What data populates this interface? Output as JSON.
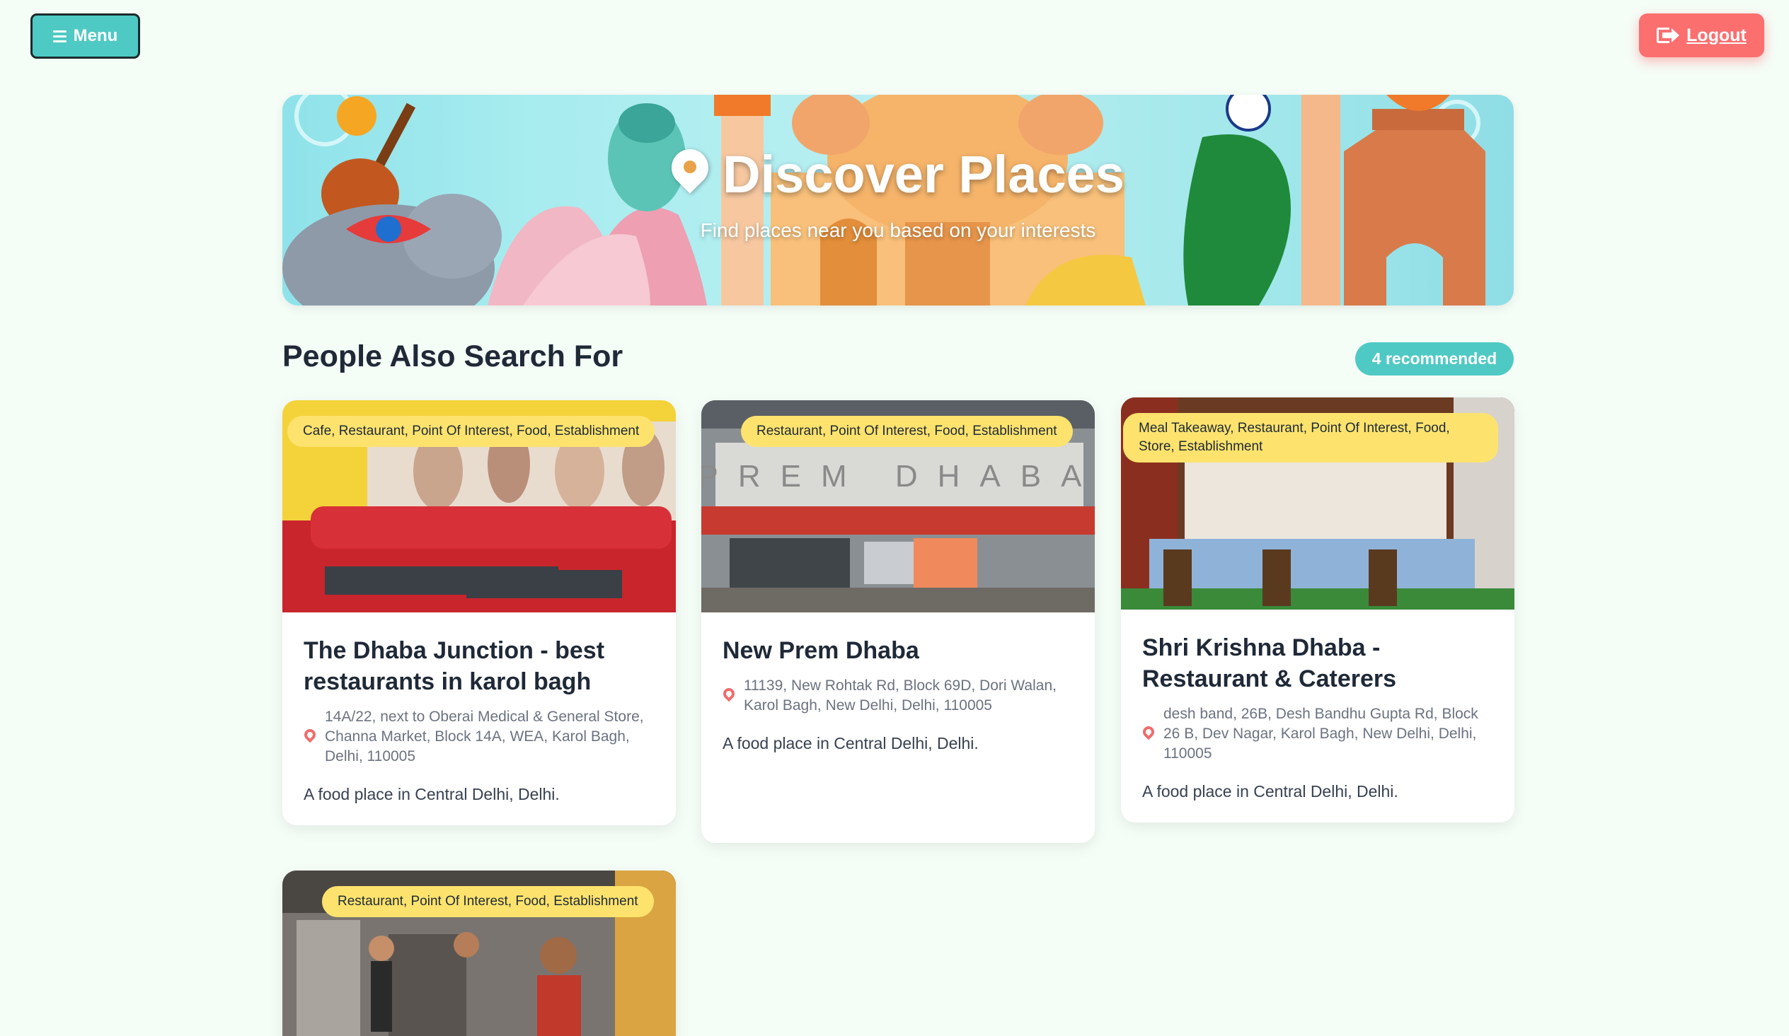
{
  "header": {
    "menu_label": "Menu",
    "logout_label": "Logout"
  },
  "hero": {
    "title": "Discover Places",
    "subtitle": "Find places near you based on your interests"
  },
  "section": {
    "title": "People Also Search For",
    "badge": "4 recommended"
  },
  "colors": {
    "accent": "#4fc9c4",
    "logout": "#fb6f6f",
    "tag": "#fde36d",
    "pin": "#f16b6b"
  },
  "cards": [
    {
      "tags": "Cafe, Restaurant, Point Of Interest, Food, Establishment",
      "title": "The Dhaba Junction - best restaurants in karol bagh",
      "address": "14A/22, next to Oberai Medical & General Store, Channa Market, Block 14A, WEA, Karol Bagh, Delhi, 110005",
      "description": "A food place in Central Delhi, Delhi."
    },
    {
      "tags": "Restaurant, Point Of Interest, Food, Establishment",
      "title": "New Prem Dhaba",
      "address": "11139, New Rohtak Rd, Block 69D, Dori Walan, Karol Bagh, New Delhi, Delhi, 110005",
      "description": "A food place in Central Delhi, Delhi.",
      "sign_text": "PREM DHABA"
    },
    {
      "tags": "Meal Takeaway, Restaurant, Point Of Interest, Food, Store, Establishment",
      "title": "Shri Krishna Dhaba - Restaurant & Caterers",
      "address": "desh band, 26B, Desh Bandhu Gupta Rd, Block 26 B, Dev Nagar, Karol Bagh, New Delhi, Delhi, 110005",
      "description": "A food place in Central Delhi, Delhi."
    },
    {
      "tags": "Restaurant, Point Of Interest, Food, Establishment"
    }
  ]
}
